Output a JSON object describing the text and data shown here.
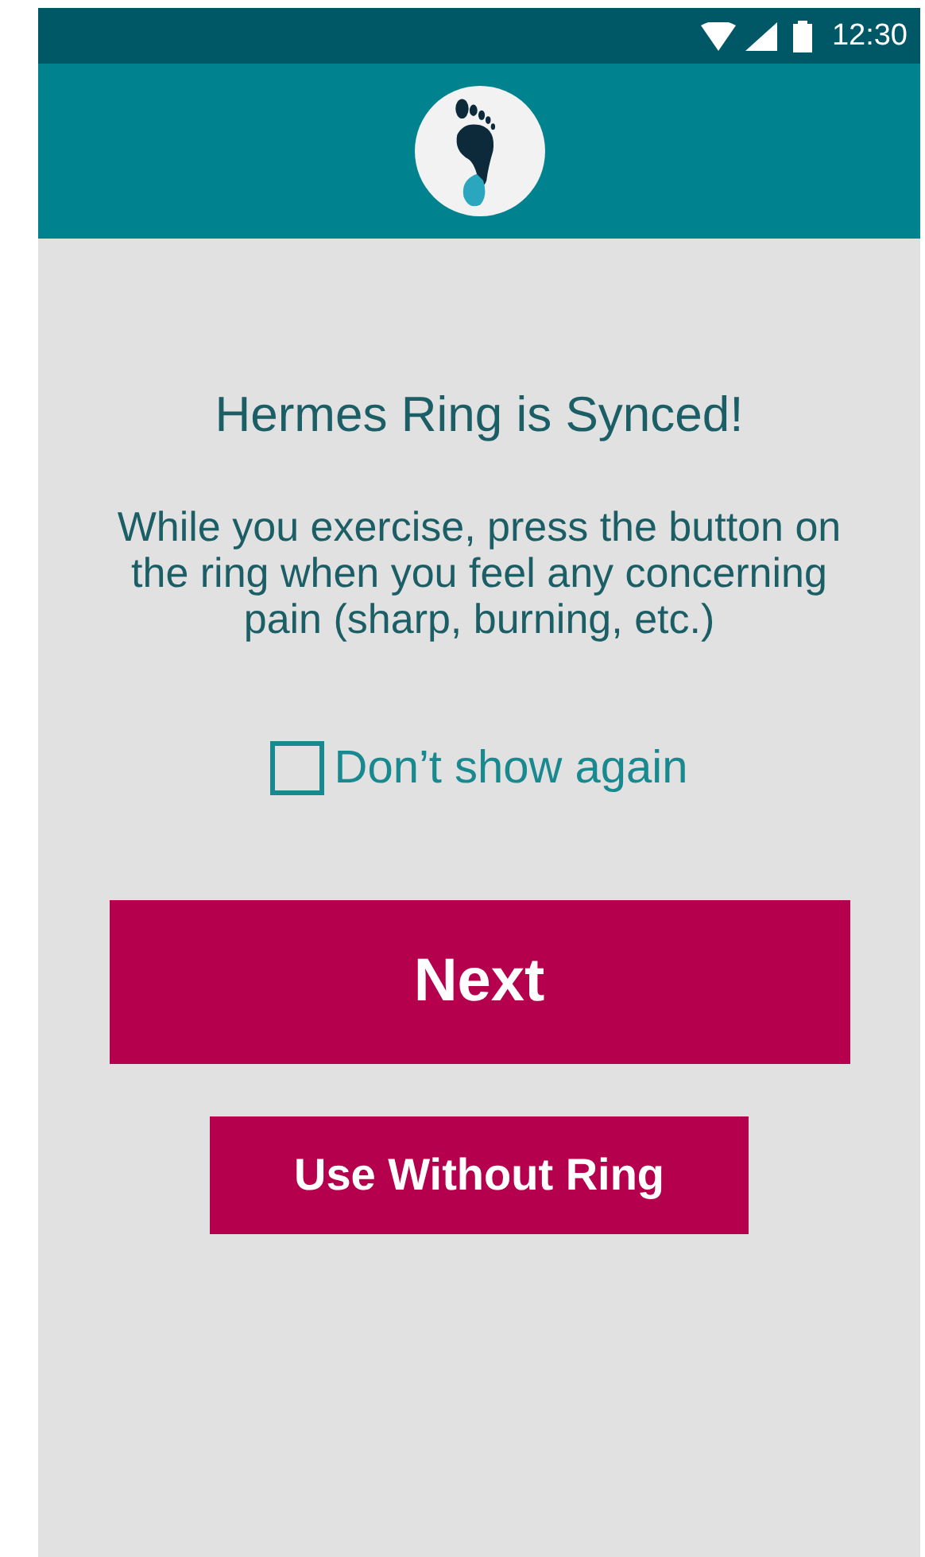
{
  "status_bar": {
    "time": "12:30"
  },
  "title": "Hermes Ring is Synced!",
  "message": "While you exercise, press the button on the ring when you feel any concerning pain (sharp, burning, etc.)",
  "dont_show_again": {
    "label": "Don’t show again",
    "checked": false
  },
  "buttons": [
    {
      "label": "Next",
      "kind": "primary"
    },
    {
      "label": "Use Without Ring",
      "kind": "secondary"
    }
  ]
}
